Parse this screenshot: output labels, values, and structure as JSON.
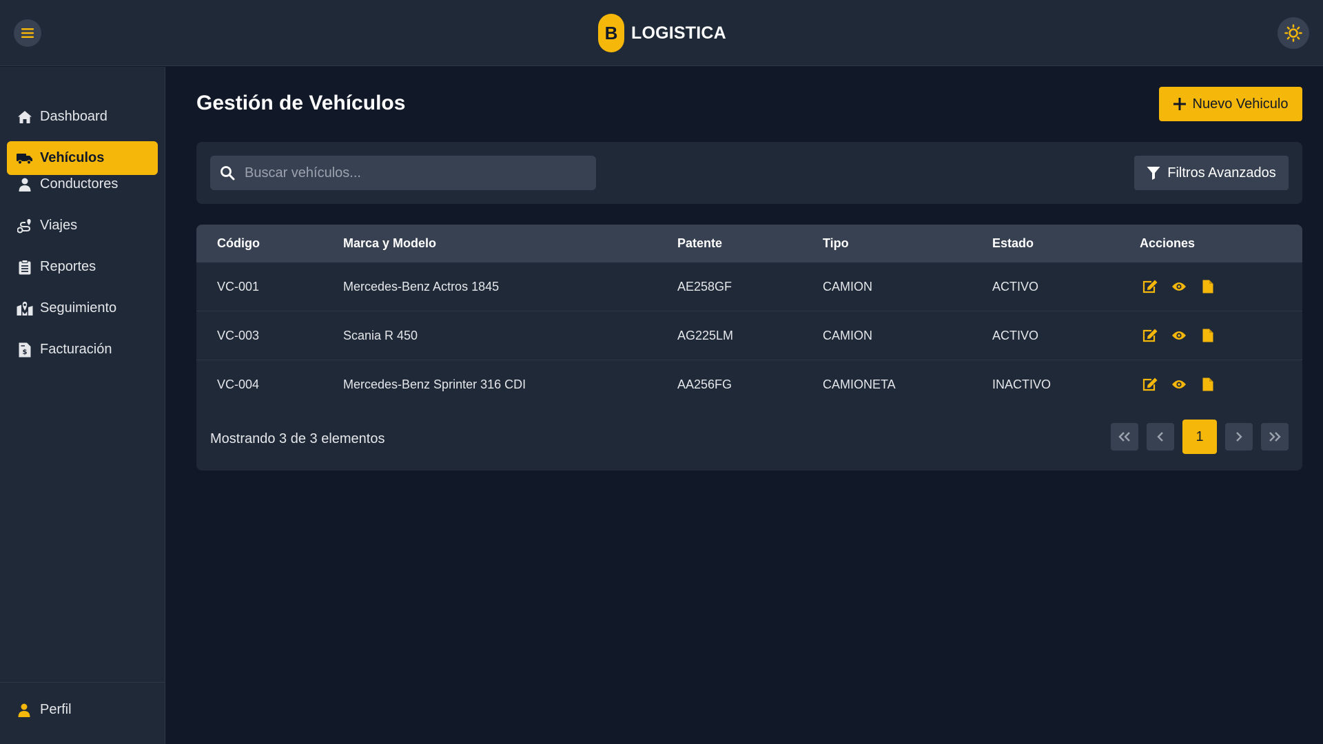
{
  "header": {
    "logo_letter": "B",
    "app_name": "LOGISTICA",
    "menu_icon": "hamburger-icon",
    "theme_icon": "sun-icon"
  },
  "colors": {
    "accent": "#f5b70a",
    "background": "#111827",
    "panel": "#1f2937",
    "control": "#374151"
  },
  "sidebar": {
    "items": [
      {
        "label": "Dashboard",
        "icon": "home-icon",
        "active": false
      },
      {
        "label": "Vehículos",
        "icon": "truck-icon",
        "active": true
      },
      {
        "label": "Conductores",
        "icon": "user-icon",
        "active": false
      },
      {
        "label": "Viajes",
        "icon": "route-icon",
        "active": false
      },
      {
        "label": "Reportes",
        "icon": "clipboard-icon",
        "active": false
      },
      {
        "label": "Seguimiento",
        "icon": "map-marker-icon",
        "active": false
      },
      {
        "label": "Facturación",
        "icon": "invoice-icon",
        "active": false
      }
    ],
    "profile_label": "Perfil"
  },
  "main": {
    "title": "Gestión de Vehículos",
    "new_button_label": "Nuevo Vehiculo",
    "search": {
      "placeholder": "Buscar vehículos...",
      "value": ""
    },
    "filter_button_label": "Filtros Avanzados",
    "table": {
      "columns": [
        "Código",
        "Marca y Modelo",
        "Patente",
        "Tipo",
        "Estado",
        "Acciones"
      ],
      "rows": [
        {
          "codigo": "VC-001",
          "modelo": "Mercedes-Benz Actros 1845",
          "patente": "AE258GF",
          "tipo": "CAMION",
          "estado": "ACTIVO"
        },
        {
          "codigo": "VC-003",
          "modelo": "Scania R 450",
          "patente": "AG225LM",
          "tipo": "CAMION",
          "estado": "ACTIVO"
        },
        {
          "codigo": "VC-004",
          "modelo": "Mercedes-Benz Sprinter 316 CDI",
          "patente": "AA256FG",
          "tipo": "CAMIONETA",
          "estado": "INACTIVO"
        }
      ],
      "row_actions": [
        "edit-icon",
        "eye-icon",
        "document-icon"
      ]
    },
    "footer_text": "Mostrando 3 de 3 elementos",
    "pagination": {
      "current_page": "1"
    }
  }
}
